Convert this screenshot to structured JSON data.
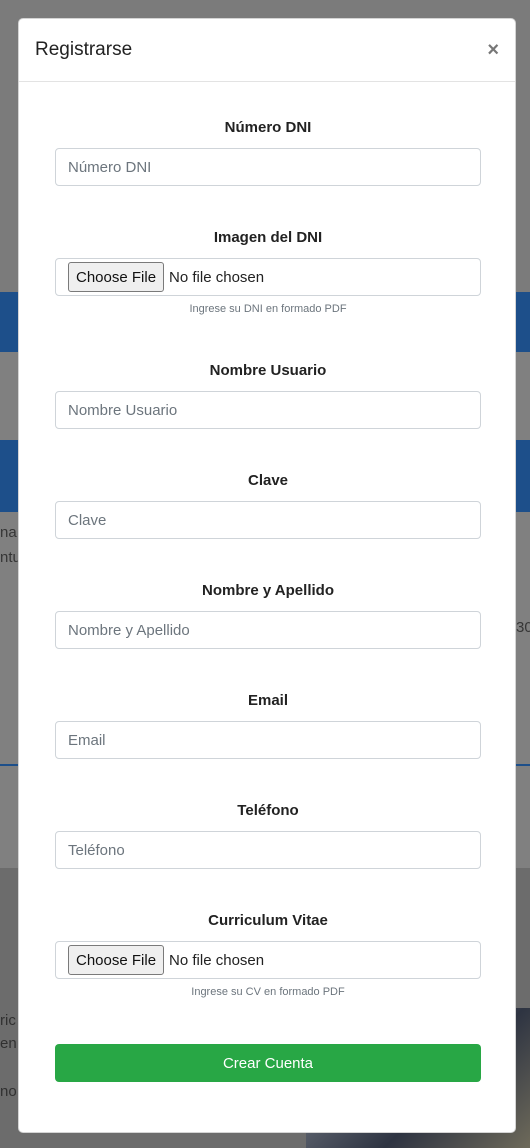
{
  "modal": {
    "title": "Registrarse",
    "close_glyph": "×"
  },
  "form": {
    "dni": {
      "label": "Número DNI",
      "placeholder": "Número DNI"
    },
    "dni_image": {
      "label": "Imagen del DNI",
      "button": "Choose File",
      "status": "No file chosen",
      "help": "Ingrese su DNI en formado PDF"
    },
    "username": {
      "label": "Nombre Usuario",
      "placeholder": "Nombre Usuario"
    },
    "password": {
      "label": "Clave",
      "placeholder": "Clave"
    },
    "fullname": {
      "label": "Nombre y Apellido",
      "placeholder": "Nombre y Apellido"
    },
    "email": {
      "label": "Email",
      "placeholder": "Email"
    },
    "phone": {
      "label": "Teléfono",
      "placeholder": "Teléfono"
    },
    "cv": {
      "label": "Curriculum Vitae",
      "button": "Choose File",
      "status": "No file chosen",
      "help": "Ingrese su CV en formado PDF"
    },
    "submit_label": "Crear Cuenta"
  },
  "background_fragments": {
    "a": "na",
    "b": "ntu",
    "c": "30",
    "d": "ric",
    "e": "en",
    "f": "no"
  },
  "colors": {
    "primary_blue": "#1d4f8a",
    "success_green": "#28a745",
    "overlay_gray": "#7b7b7b"
  }
}
